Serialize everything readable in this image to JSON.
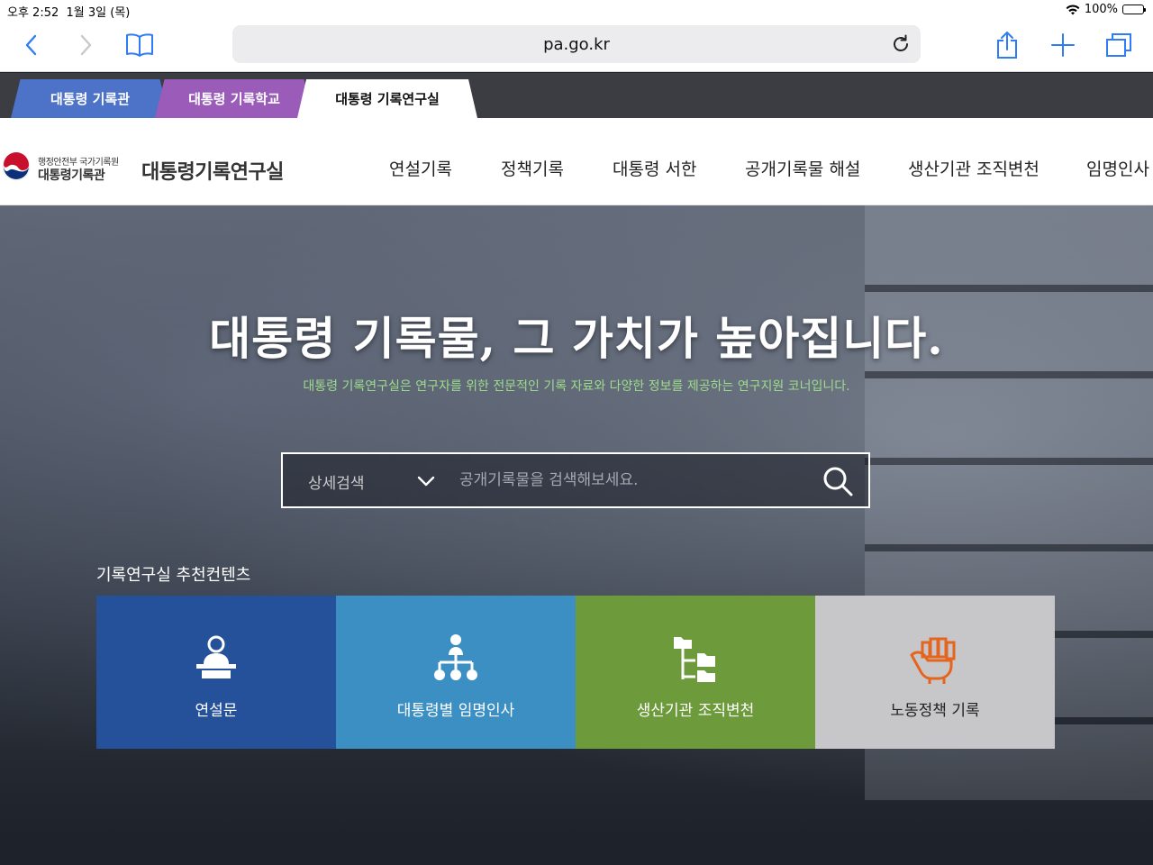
{
  "status_bar": {
    "time": "오후 2:52",
    "date": "1월 3일 (목)",
    "battery": "100%"
  },
  "browser": {
    "url": "pa.go.kr"
  },
  "site_tabs": [
    {
      "label": "대통령 기록관",
      "color": "#4d73c9"
    },
    {
      "label": "대통령 기록학교",
      "color": "#9a5cb8"
    },
    {
      "label": "대통령 기록연구실",
      "color": "#ffffff"
    }
  ],
  "header": {
    "logo_sub": "행정안전부 국가기록원",
    "logo_main": "대통령기록관",
    "site_title": "대통령기록연구실",
    "nav": [
      "연설기록",
      "정책기록",
      "대통령 서한",
      "공개기록물 해설",
      "생산기관 조직변천",
      "임명인사"
    ]
  },
  "hero": {
    "headline": "대통령 기록물, 그 가치가 높아집니다.",
    "subline": "대통령 기록연구실은 연구자를 위한 전문적인 기록 자료와 다양한 정보를 제공하는 연구지원 코너입니다."
  },
  "search": {
    "select_label": "상세검색",
    "placeholder": "공개기록물을 검색해보세요."
  },
  "recommend": {
    "title": "기록연구실 추천컨텐츠",
    "cards": [
      {
        "label": "연설문",
        "icon": "speaker-podium-icon",
        "color": "#25519a"
      },
      {
        "label": "대통령별 임명인사",
        "icon": "org-chart-icon",
        "color": "#3b8fc3"
      },
      {
        "label": "생산기관 조직변천",
        "icon": "folder-tree-icon",
        "color": "#6d9b3c"
      },
      {
        "label": "노동정책 기록",
        "icon": "fist-icon",
        "color": "#c7c7c9"
      }
    ]
  }
}
